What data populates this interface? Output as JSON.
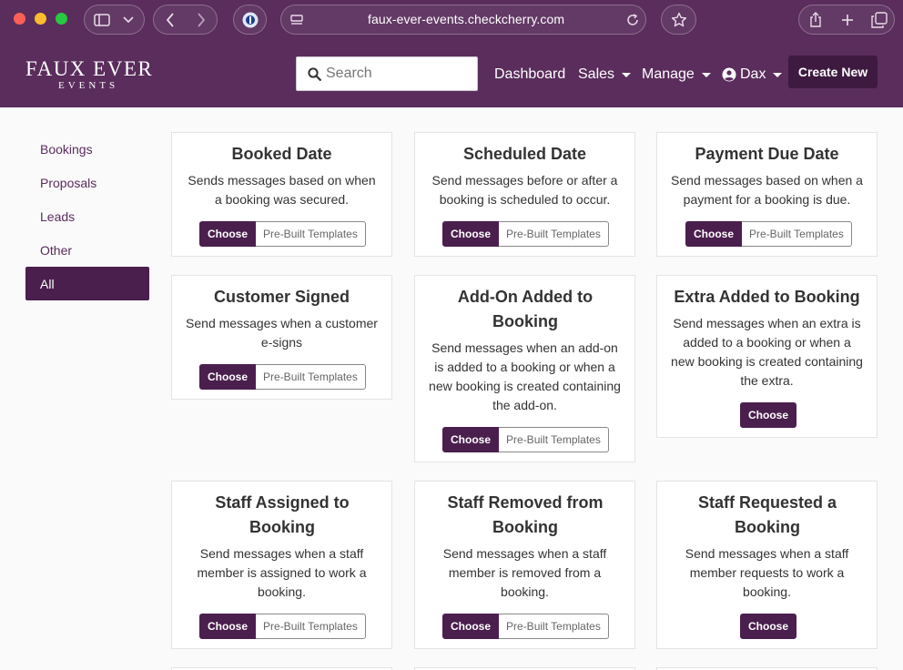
{
  "browser": {
    "url": "faux-ever-events.checkcherry.com"
  },
  "brand": {
    "logo_top": "FAUX EVER",
    "logo_bottom": "EVENTS"
  },
  "search": {
    "placeholder": "Search"
  },
  "nav": {
    "dashboard": "Dashboard",
    "sales": "Sales",
    "manage": "Manage",
    "user": "Dax",
    "create_new": "Create New"
  },
  "sidebar": {
    "items": [
      {
        "label": "Bookings"
      },
      {
        "label": "Proposals"
      },
      {
        "label": "Leads"
      },
      {
        "label": "Other"
      },
      {
        "label": "All",
        "active": true
      }
    ]
  },
  "buttons": {
    "choose": "Choose",
    "templates": "Pre-Built Templates"
  },
  "cards": [
    {
      "title": "Booked Date",
      "description": "Sends messages based on when a booking was secured.",
      "has_templates": true
    },
    {
      "title": "Scheduled Date",
      "description": "Send messages before or after a booking is scheduled to occur.",
      "has_templates": true
    },
    {
      "title": "Payment Due Date",
      "description": "Send messages based on when a payment for a booking is due.",
      "has_templates": true
    },
    {
      "title": "Customer Signed",
      "description": "Send messages when a customer e-signs",
      "has_templates": true
    },
    {
      "title": "Add-On Added to Booking",
      "description": "Send messages when an add-on is added to a booking or when a new booking is created containing the add-on.",
      "has_templates": true
    },
    {
      "title": "Extra Added to Booking",
      "description": "Send messages when an extra is added to a booking or when a new booking is created containing the extra.",
      "has_templates": false
    },
    {
      "title": "Staff Assigned to Booking",
      "description": "Send messages when a staff member is assigned to work a booking.",
      "has_templates": true
    },
    {
      "title": "Staff Removed from Booking",
      "description": "Send messages when a staff member is removed from a booking.",
      "has_templates": true
    },
    {
      "title": "Staff Requested a Booking",
      "description": "Send messages when a staff member requests to work a booking.",
      "has_templates": false
    }
  ],
  "colors": {
    "brand": "#5a2d5c",
    "brand_dark": "#4a1f4d",
    "active_sidebar": "#4a1f4d"
  }
}
